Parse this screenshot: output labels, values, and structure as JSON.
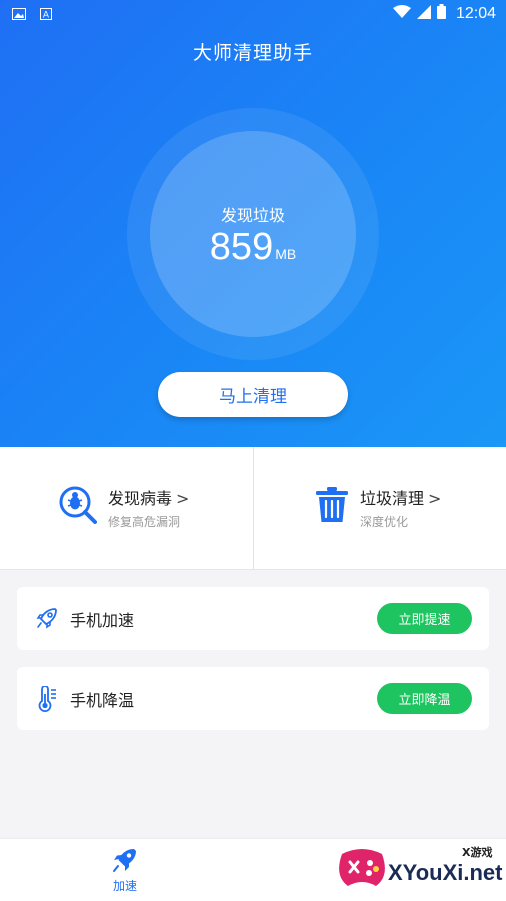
{
  "status_bar": {
    "time": "12:04",
    "left_icons": [
      "image-icon",
      "a-icon"
    ],
    "right_icons": [
      "wifi-icon",
      "signal-icon",
      "battery-icon"
    ]
  },
  "header": {
    "title": "大师清理助手"
  },
  "scan": {
    "label": "发现垃圾",
    "amount": "859",
    "unit": "MB"
  },
  "clean_button": {
    "label": "马上清理"
  },
  "features": [
    {
      "title": "发现病毒",
      "subtitle": "修复高危漏洞",
      "icon": "virus-scan-icon"
    },
    {
      "title": "垃圾清理",
      "subtitle": "深度优化",
      "icon": "trash-icon"
    }
  ],
  "chevron": ">",
  "cards": [
    {
      "label": "手机加速",
      "button": "立即提速",
      "icon": "rocket-icon"
    },
    {
      "label": "手机降温",
      "button": "立即降温",
      "icon": "thermometer-icon"
    }
  ],
  "bottom_nav": {
    "accelerate_label": "加速"
  },
  "watermark": {
    "brand": "XYouXi.net",
    "small": "X游戏"
  },
  "colors": {
    "primary": "#1f6ff4",
    "accent_green": "#1ec45f",
    "background": "#f4f4f6"
  }
}
